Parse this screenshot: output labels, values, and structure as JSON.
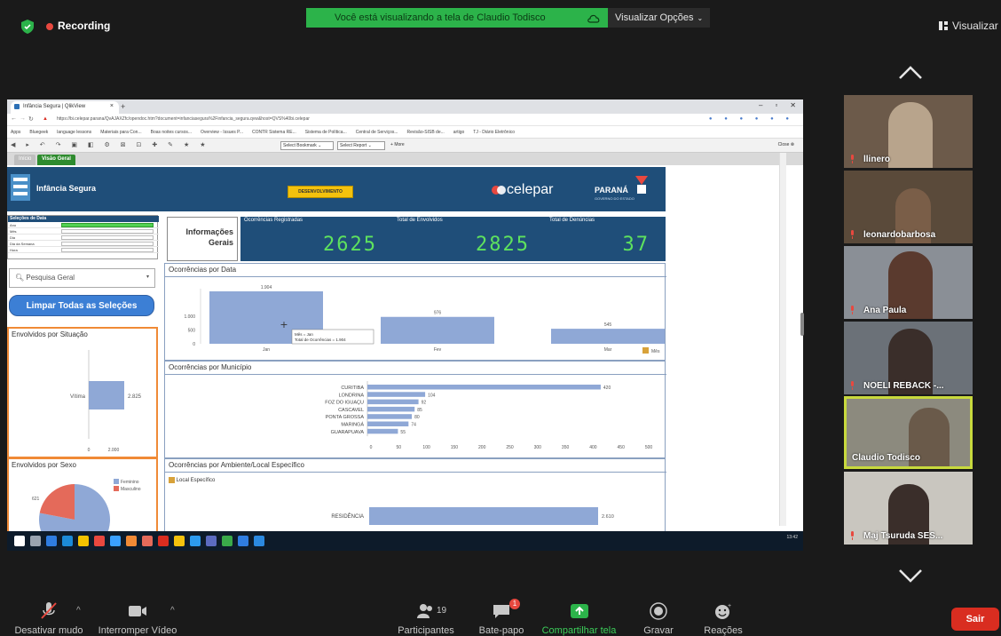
{
  "zoom": {
    "recording_label": "Recording",
    "share_banner": "Você está visualizando a tela de Claudio Todisco",
    "view_options": "Visualizar Opções",
    "view_right": "Visualizar",
    "controls": [
      {
        "label": "Desativar mudo",
        "icon": "muted-mic-icon"
      },
      {
        "label": "Interromper Vídeo",
        "icon": "video-camera-icon"
      },
      {
        "label": "Participantes",
        "icon": "participants-icon",
        "count": "19"
      },
      {
        "label": "Bate-papo",
        "icon": "chat-icon",
        "badge": "1"
      },
      {
        "label": "Compartilhar tela",
        "icon": "share-screen-icon"
      },
      {
        "label": "Gravar",
        "icon": "record-icon"
      },
      {
        "label": "Reações",
        "icon": "reactions-icon"
      }
    ],
    "leave_label": "Sair",
    "participants": [
      {
        "name": "llinero"
      },
      {
        "name": "leonardobarbosa"
      },
      {
        "name": "Ana Paula"
      },
      {
        "name": "NOELI REBACK -..."
      },
      {
        "name": "Claudio Todisco"
      },
      {
        "name": "Maj Tsuruda SES..."
      }
    ],
    "colors": {
      "share_green": "#2cb34a",
      "leave_red": "#d92d20",
      "active_speaker": "#c8d93d"
    }
  },
  "browser": {
    "tab_title": "Infância Segura | QlikView",
    "address": "https://bi.celepar.parana/QvAJAXZfc/opendoc.htm?document=infanciasegura%2Finfancia_segura.qvw&host=QVS%40bi.celepar",
    "bookmarks": [
      "Apps",
      "Bluegeek",
      "language lessons",
      "Materiais para Con...",
      "Boas noites cursos...",
      "Overview - Issues P...",
      "CONTR Sistema RE...",
      "Sistema de Política...",
      "Central de Serviços...",
      "Revisão-SISB de...",
      "artigo",
      "TJ - Diário Eletrônico"
    ],
    "qv_toolbar": {
      "close_label": "Close",
      "bookmark_select": "Select Bookmark",
      "report_select": "Select Report",
      "more_label": "More"
    },
    "sheet_tabs": [
      "Início",
      "Visão Geral"
    ]
  },
  "dashboard": {
    "brand": "Infância Segura",
    "dev_badge": "DESENVOLVIMENTO",
    "celepar": "celepar",
    "parana": "PARANÁ",
    "parana_sub": "GOVERNO DO ESTADO",
    "selections": {
      "title": "Seleções de Data",
      "rows": [
        "Ano",
        "Mês",
        "Dia",
        "Dia da Semana",
        "Hora"
      ]
    },
    "search_placeholder": "Pesquisa Geral",
    "clear_button": "Limpar Todas as Seleções",
    "info_geral": "Informações Gerais",
    "kpis": [
      {
        "title": "Ocorrências Registradas",
        "value": "2625"
      },
      {
        "title": "Total de Envolvidos",
        "value": "2825"
      },
      {
        "title": "Total de Denúncias",
        "value": "37"
      }
    ],
    "env_situacao_title": "Envolvidos por Situação",
    "env_sexo_title": "Envolvidos por Sexo",
    "occ_data_title": "Ocorrências por Data",
    "occ_mun_title": "Ocorrências por Município",
    "occ_amb_title": "Ocorrências por Ambiente/Local Específico",
    "amb_drill_label": "Local Específico",
    "tooltip_line1": "Mês = Jan",
    "tooltip_line2": "Total de Ocorrências = 1.904",
    "mes_label": "Mês",
    "clock": "13:42"
  },
  "chart_data": [
    {
      "type": "bar",
      "title": "Envolvidos por Situação",
      "categories": [
        "Vítima"
      ],
      "values": [
        2825
      ],
      "xlim": [
        0,
        2000
      ],
      "xticks": [
        "0",
        "2.000"
      ],
      "data_labels": [
        "2.825"
      ]
    },
    {
      "type": "pie",
      "title": "Envolvidos por Sexo",
      "categories": [
        "Feminino",
        "Masculino"
      ],
      "values": [
        2204,
        621
      ],
      "visible_labels": [
        "621"
      ],
      "colors": [
        "#8fa8d6",
        "#e46a5a"
      ]
    },
    {
      "type": "bar",
      "title": "Ocorrências por Data",
      "categories": [
        "Jan",
        "Fev",
        "Mar"
      ],
      "values": [
        1904,
        976,
        545
      ],
      "data_labels": [
        "1.904",
        "976",
        "545"
      ],
      "yticks": [
        "0",
        "500",
        "1.000"
      ],
      "ylim": [
        0,
        2000
      ],
      "xlabel": "Mês"
    },
    {
      "type": "bar",
      "title": "Ocorrências por Município",
      "categories": [
        "CURITIBA",
        "LONDRINA",
        "FOZ DO IGUAÇU",
        "CASCAVEL",
        "PONTA GROSSA",
        "MARINGÁ",
        "GUARAPUAVA"
      ],
      "values": [
        420,
        104,
        92,
        85,
        80,
        74,
        55
      ],
      "xticks": [
        "0",
        "50",
        "100",
        "150",
        "200",
        "250",
        "300",
        "350",
        "400",
        "450",
        "500"
      ],
      "xlim": [
        0,
        500
      ]
    },
    {
      "type": "bar",
      "title": "Ocorrências por Ambiente/Local Específico",
      "categories": [
        "RESIDÊNCIA"
      ],
      "values": [
        2610
      ],
      "data_labels": [
        "2.610"
      ]
    }
  ]
}
